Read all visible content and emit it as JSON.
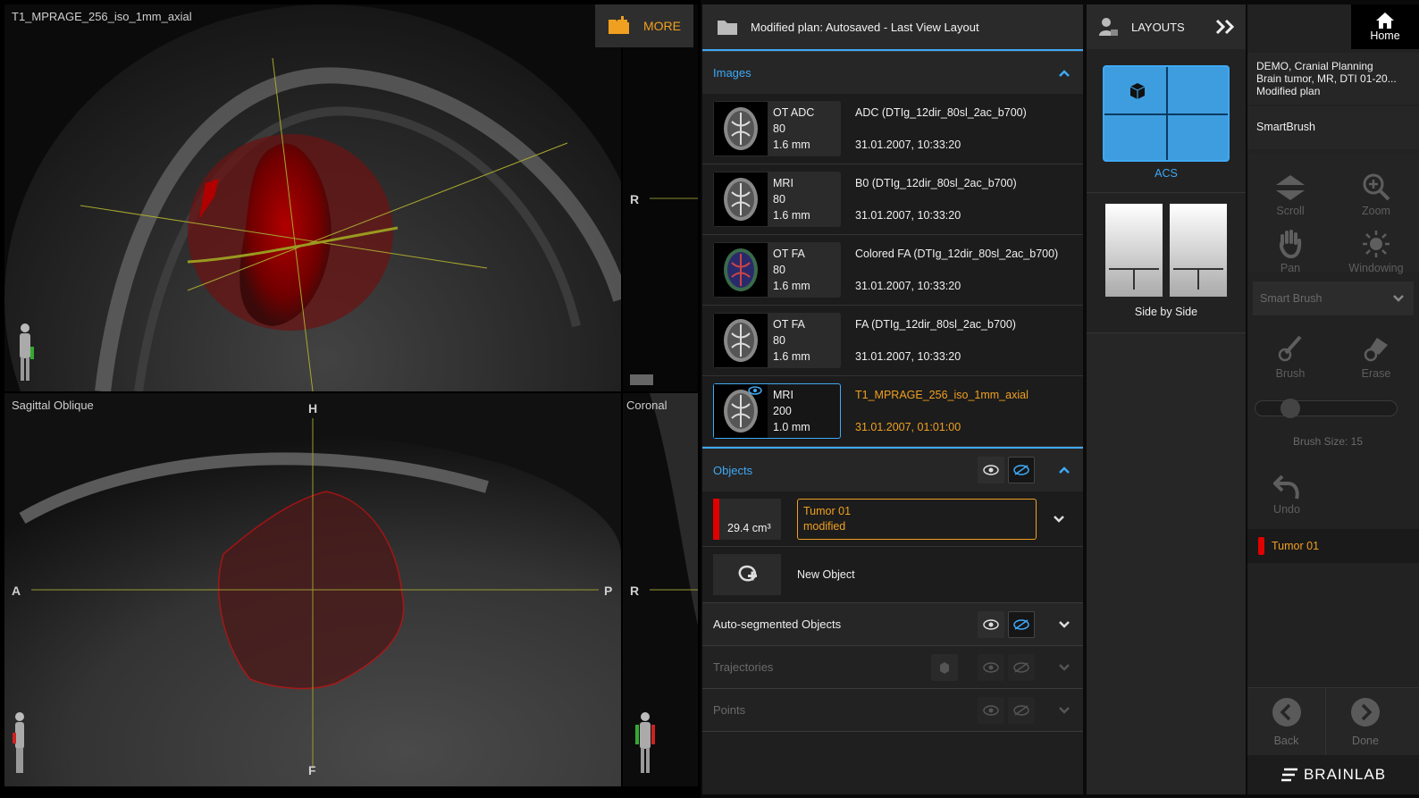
{
  "viewer": {
    "top_viewport": {
      "label": "T1_MPRAGE_256_iso_1mm_axial",
      "right_orientation": "R"
    },
    "bottom_left_viewport": {
      "label": "Sagittal Oblique",
      "orient_top": "H",
      "orient_bottom": "F",
      "orient_left": "A",
      "orient_right": "P"
    },
    "bottom_right_viewport": {
      "label": "Coronal",
      "orient_left": "R"
    },
    "more_label": "MORE"
  },
  "data_panel": {
    "title": "Modified plan: Autosaved - Last View Layout",
    "images_section": "Images",
    "images": [
      {
        "modality": "OT ADC",
        "slices": "80",
        "thickness": "1.6 mm",
        "name": "ADC (DTIg_12dir_80sl_2ac_b700)",
        "date": "31.01.2007, 10:33:20",
        "selected": false
      },
      {
        "modality": "MRI",
        "slices": "80",
        "thickness": "1.6 mm",
        "name": "B0 (DTIg_12dir_80sl_2ac_b700)",
        "date": "31.01.2007, 10:33:20",
        "selected": false
      },
      {
        "modality": "OT FA",
        "slices": "80",
        "thickness": "1.6 mm",
        "name": "Colored FA (DTIg_12dir_80sl_2ac_b700)",
        "date": "31.01.2007, 10:33:20",
        "selected": false
      },
      {
        "modality": "OT FA",
        "slices": "80",
        "thickness": "1.6 mm",
        "name": "FA (DTIg_12dir_80sl_2ac_b700)",
        "date": "31.01.2007, 10:33:20",
        "selected": false
      },
      {
        "modality": "MRI",
        "slices": "200",
        "thickness": "1.0 mm",
        "name": "T1_MPRAGE_256_iso_1mm_axial",
        "date": "31.01.2007, 01:01:00",
        "selected": true
      }
    ],
    "objects_section": "Objects",
    "tumor": {
      "volume": "29.4 cm³",
      "name": "Tumor 01",
      "status": "modified",
      "color": "#e00000"
    },
    "new_object": "New Object",
    "auto_segmented": "Auto-segmented Objects",
    "trajectories": "Trajectories",
    "points": "Points"
  },
  "layouts": {
    "title": "LAYOUTS",
    "items": [
      {
        "label": "ACS",
        "selected": true
      },
      {
        "label": "Side by Side",
        "selected": false
      }
    ]
  },
  "home_label": "Home",
  "tools": {
    "patient_line1": "DEMO, Cranial Planning",
    "patient_line2": "Brain tumor, MR, DTI 01-20...",
    "patient_line3": "Modified plan",
    "tool_title": "SmartBrush",
    "scroll": "Scroll",
    "zoom": "Zoom",
    "pan": "Pan",
    "windowing": "Windowing",
    "dropdown": "Smart Brush",
    "brush": "Brush",
    "erase": "Erase",
    "brush_size_label": "Brush Size: 15",
    "brush_size": 15,
    "undo": "Undo",
    "object_name": "Tumor 01",
    "back": "Back",
    "done": "Done",
    "logo": "BRAINLAB"
  },
  "colors": {
    "accent_blue": "#3fa9f5",
    "accent_orange": "#f0a020",
    "tumor_red": "#e00000"
  }
}
